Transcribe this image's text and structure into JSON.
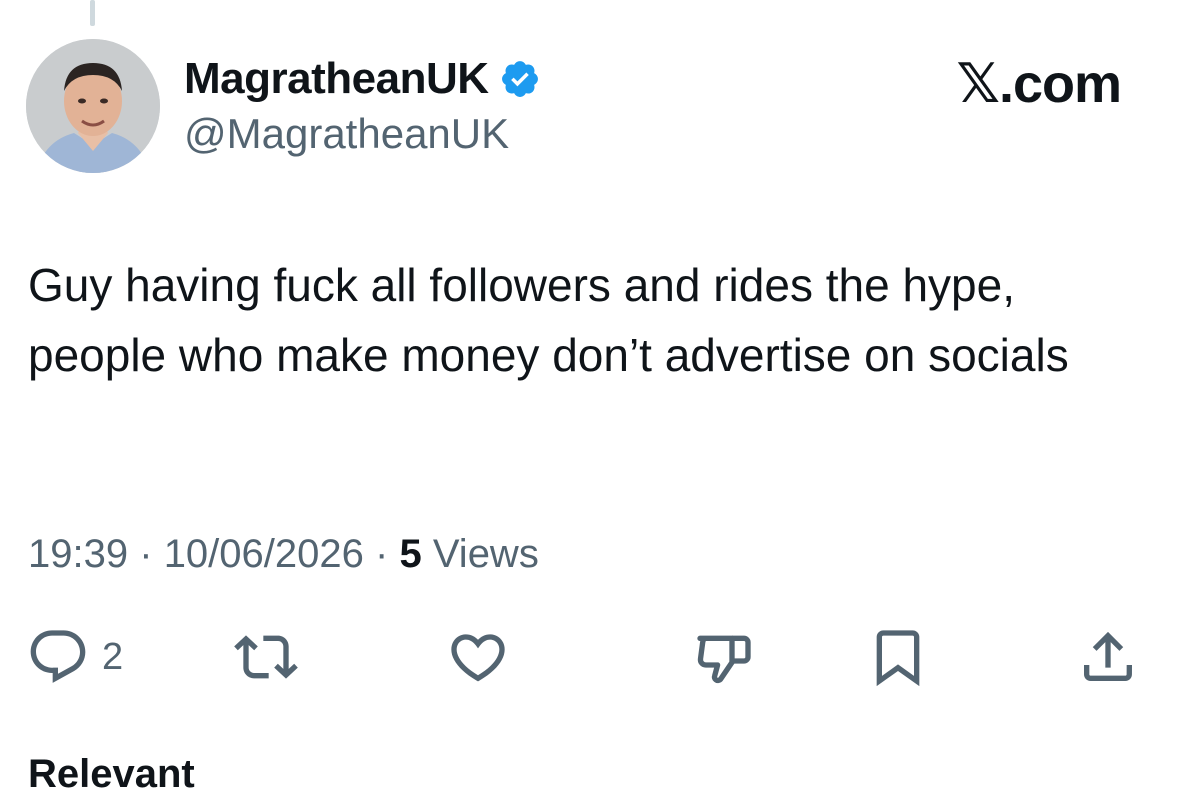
{
  "tweet": {
    "display_name": "MagratheanUK",
    "handle": "@MagratheanUK",
    "verified": true,
    "text": "Guy having fuck all followers and rides the hype, people who make money don’t advertise on socials",
    "time": "19:39",
    "separator": "·",
    "date": "10/06/2026",
    "views_count": "5",
    "views_label": "Views"
  },
  "site": {
    "logo_letter": "𝕏",
    "logo_suffix": ".com"
  },
  "actions": {
    "reply_count": "2",
    "icons": [
      "reply-icon",
      "repost-icon",
      "like-icon",
      "dislike-icon",
      "bookmark-icon",
      "share-icon"
    ]
  },
  "colors": {
    "verified_blue": "#1d9bf0",
    "secondary_text": "#536471",
    "primary_text": "#0f1419"
  },
  "partial_next": "Relevant"
}
